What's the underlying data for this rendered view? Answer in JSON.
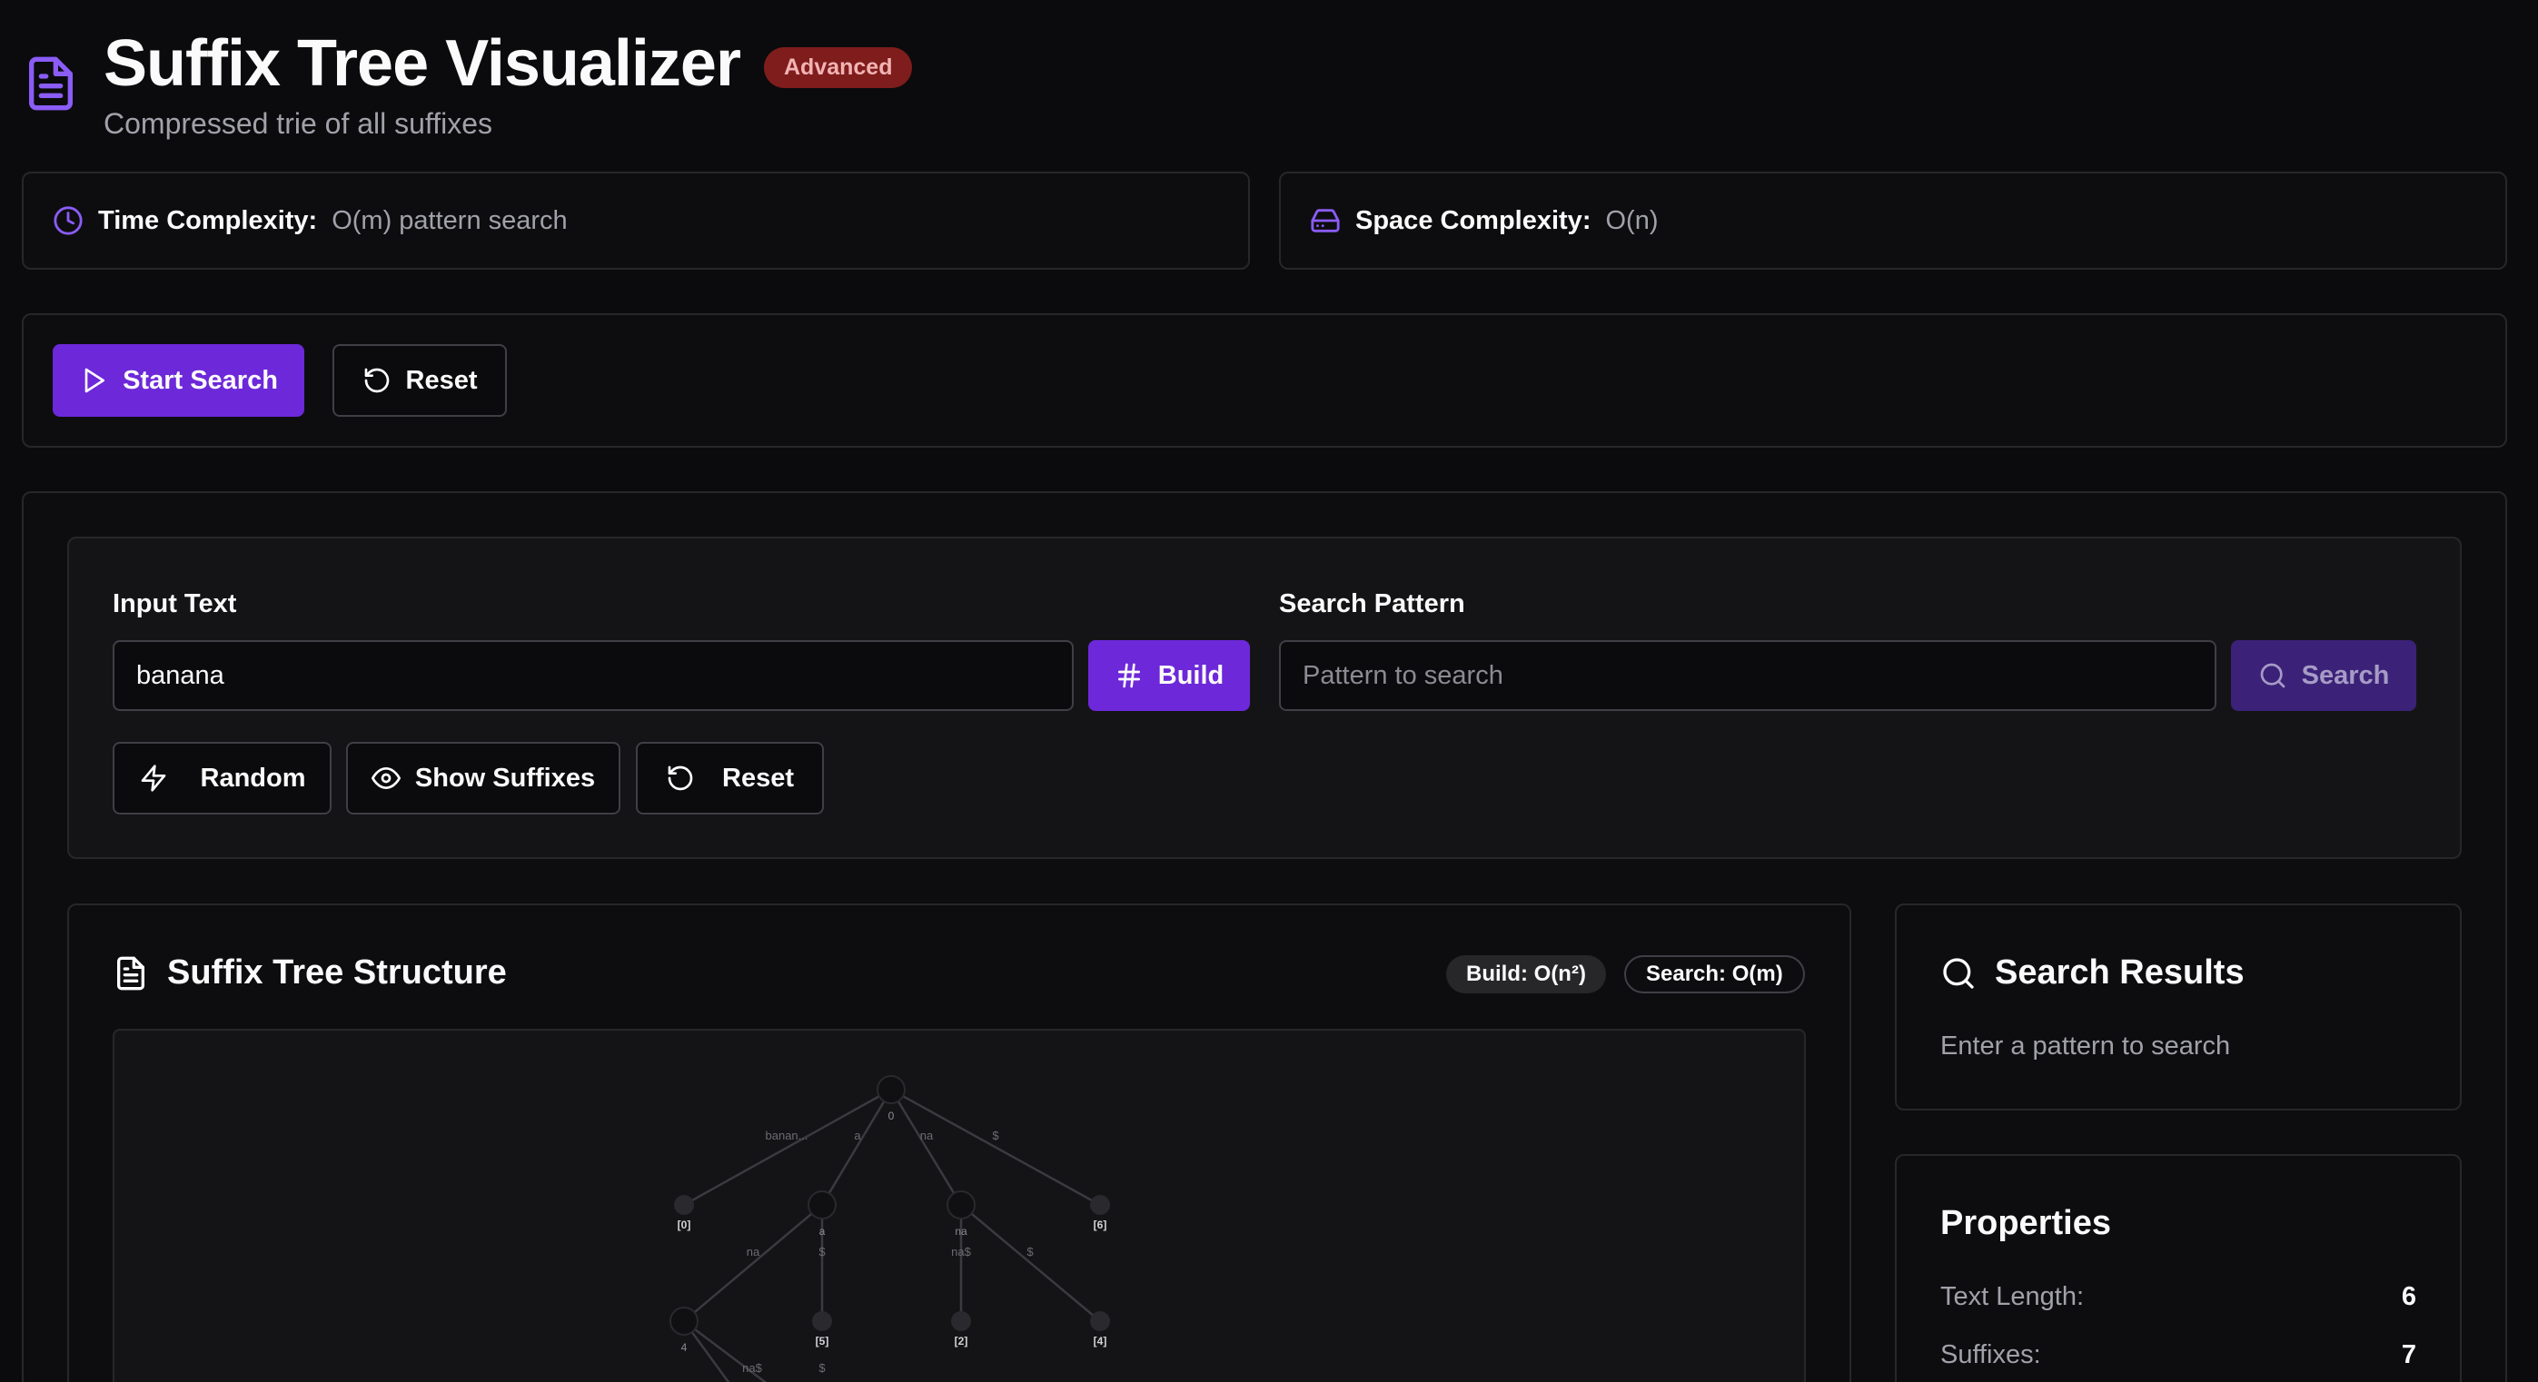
{
  "header": {
    "title": "Suffix Tree Visualizer",
    "badge": "Advanced",
    "subtitle": "Compressed trie of all suffixes",
    "icon": "file-text-icon"
  },
  "complexity": {
    "time_label": "Time Complexity:",
    "time_value": "O(m) pattern search",
    "space_label": "Space Complexity:",
    "space_value": "O(n)"
  },
  "controls": {
    "start_label": "Start Search",
    "reset_label": "Reset"
  },
  "inputs": {
    "text_label": "Input Text",
    "text_value": "banana",
    "build_label": "Build",
    "pattern_label": "Search Pattern",
    "pattern_placeholder": "Pattern to search",
    "search_label": "Search",
    "random_label": "Random",
    "show_suffixes_label": "Show Suffixes",
    "reset_label": "Reset"
  },
  "tree": {
    "title": "Suffix Tree Structure",
    "build_badge": "Build: O(n²)",
    "search_badge": "Search: O(m)",
    "nodes": {
      "root": "0",
      "leaf0": "[0]",
      "a": "a",
      "na": "na",
      "leaf6": "[6]",
      "n4": "4",
      "leaf5": "[5]",
      "leaf2": "[2]",
      "leaf4": "[4]"
    },
    "edges": {
      "e_banan": "banan...",
      "e_a": "a",
      "e_na": "na",
      "e_dollar1": "$",
      "e_a_na": "na",
      "e_a_dollar": "$",
      "e_na_nas": "na$",
      "e_na_dollar": "$",
      "e_4_nas": "na$",
      "e_4_dollar": "$"
    }
  },
  "results": {
    "title": "Search Results",
    "empty_text": "Enter a pattern to search"
  },
  "properties": {
    "title": "Properties",
    "rows": [
      {
        "label": "Text Length:",
        "value": "6"
      },
      {
        "label": "Suffixes:",
        "value": "7"
      }
    ]
  },
  "colors": {
    "accent": "#6d28d9",
    "icon_accent": "#8b5cf6",
    "badge_red": "#7f1d1d"
  }
}
